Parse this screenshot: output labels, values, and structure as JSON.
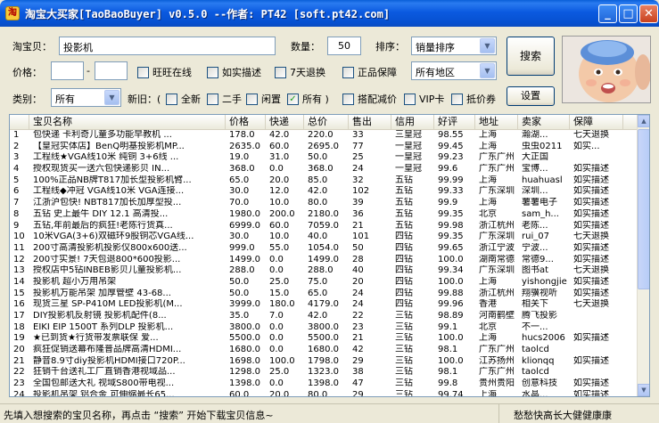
{
  "window": {
    "title": "淘宝大买家[TaoBaoBuyer] v0.5.0 --作者: PT42 [soft.pt42.com]",
    "icon": "app-icon"
  },
  "search": {
    "keyword_label": "淘宝贝：",
    "keyword_value": "投影机",
    "count_label": "数量：",
    "count_value": "50",
    "sort_label": "排序：",
    "sort_value": "销量排序",
    "search_button": "搜索",
    "price_label": "价格：",
    "price_from": "",
    "price_to": "",
    "price_sep": "-",
    "region_value": "所有地区",
    "category_label": "类别：",
    "category_value": "所有",
    "new_label": "新旧：(",
    "settings_button": "设置"
  },
  "filters": [
    {
      "label": "旺旺在线",
      "checked": false
    },
    {
      "label": "如实描述",
      "checked": false
    },
    {
      "label": "7天退换",
      "checked": false
    },
    {
      "label": "正品保障",
      "checked": false
    }
  ],
  "condition_options": [
    {
      "label": "全新",
      "checked": false
    },
    {
      "label": "二手",
      "checked": false
    },
    {
      "label": "闲置",
      "checked": false
    },
    {
      "label": "所有 )",
      "checked": true
    }
  ],
  "extra_filters": [
    {
      "label": "搭配减价",
      "checked": false
    },
    {
      "label": "VIP卡",
      "checked": false
    },
    {
      "label": "抵价券",
      "checked": false
    }
  ],
  "table": {
    "columns": [
      "",
      "宝贝名称",
      "价格",
      "快递",
      "总价",
      "售出",
      "信用",
      "好评",
      "地址",
      "卖家",
      "保障"
    ],
    "rows": [
      [
        "1",
        "包快递 卡利奇儿童多功能早教机 ...",
        "178.0",
        "42.0",
        "220.0",
        "33",
        "三皇冠",
        "98.55",
        "上海",
        "瀚湖...",
        "七天退换"
      ],
      [
        "2",
        "【皇冠实体店】BenQ明基投影机MP...",
        "2635.0",
        "60.0",
        "2695.0",
        "77",
        "一皇冠",
        "99.45",
        "上海",
        "虫虫0211",
        "如实..."
      ],
      [
        "3",
        "工程线★VGA线10米 纯铜 3+6线 ...",
        "19.0",
        "31.0",
        "50.0",
        "25",
        "一皇冠",
        "99.23",
        "广东广州",
        "大正国",
        ""
      ],
      [
        "4",
        "授权现货买一送六包快递影贝 IN...",
        "368.0",
        "0.0",
        "368.0",
        "24",
        "一皇冠",
        "99.6",
        "广东广州",
        "宝博...",
        "如实描述"
      ],
      [
        "5",
        "100%正品NB牌T817加长型投影机臂...",
        "65.0",
        "20.0",
        "85.0",
        "32",
        "五钻",
        "99.99",
        "上海",
        "huahuasl",
        "如实描述"
      ],
      [
        "6",
        "工程线◆冲冠 VGA线10米 VGA连接...",
        "30.0",
        "12.0",
        "42.0",
        "102",
        "五钻",
        "99.33",
        "广东深圳",
        "深圳...",
        "如实描述"
      ],
      [
        "7",
        "江浙沪包快! NBT817加长加厚型投...",
        "70.0",
        "10.0",
        "80.0",
        "39",
        "五钻",
        "99.9",
        "上海",
        "薯薯电子",
        "如实描述"
      ],
      [
        "8",
        "五钻 史上最牛 DIY 12.1 高清投...",
        "1980.0",
        "200.0",
        "2180.0",
        "36",
        "五钻",
        "99.35",
        "北京",
        "sam_h...",
        "如实描述"
      ],
      [
        "9",
        "五钻,年前最后的疯狂!老陈行货真...",
        "6999.0",
        "60.0",
        "7059.0",
        "21",
        "五钻",
        "99.98",
        "浙江杭州",
        "老陈...",
        "如实描述"
      ],
      [
        "10",
        "10米VGA(3+6)双磁环9股铜芯VGA线...",
        "30.0",
        "10.0",
        "40.0",
        "101",
        "四钻",
        "99.35",
        "广东深圳",
        "rui_07",
        "七天退换"
      ],
      [
        "11",
        "200寸高清投影机投影仪800x600送...",
        "999.0",
        "55.0",
        "1054.0",
        "50",
        "四钻",
        "99.65",
        "浙江宁波",
        "宁波...",
        "如实描述"
      ],
      [
        "12",
        "200寸实景! 7天包退800*600投影...",
        "1499.0",
        "0.0",
        "1499.0",
        "28",
        "四钻",
        "100.0",
        "湖南常德",
        "常德9...",
        "如实描述"
      ],
      [
        "13",
        "授权店中5钻INBEB影贝儿童投影机...",
        "288.0",
        "0.0",
        "288.0",
        "40",
        "四钻",
        "99.34",
        "广东深圳",
        "图书at",
        "七天退换"
      ],
      [
        "14",
        "投影机 超小万用吊架",
        "50.0",
        "25.0",
        "75.0",
        "20",
        "四钻",
        "100.0",
        "上海",
        "yishongjie",
        "如实描述"
      ],
      [
        "15",
        "投影机万能吊架 加厚管壁 43-68...",
        "50.0",
        "15.0",
        "65.0",
        "24",
        "四钻",
        "99.88",
        "浙江杭州",
        "翔骥视听",
        "如实描述"
      ],
      [
        "16",
        "现货三星 SP-P410M LED投影机(M...",
        "3999.0",
        "180.0",
        "4179.0",
        "24",
        "四钻",
        "99.96",
        "香港",
        "相关下",
        "七天退换"
      ],
      [
        "17",
        "DIY投影机反射镜 投影机配件(8...",
        "35.0",
        "7.0",
        "42.0",
        "22",
        "三钻",
        "98.89",
        "河南鹤壁",
        "腾飞投影",
        ""
      ],
      [
        "18",
        "EIKI EIP 1500T 系列DLP 投影机...",
        "3800.0",
        "0.0",
        "3800.0",
        "23",
        "三钻",
        "99.1",
        "北京",
        "不一...",
        ""
      ],
      [
        "19",
        "★已到货★行货带发票联保 爱...",
        "5500.0",
        "0.0",
        "5500.0",
        "21",
        "三钻",
        "100.0",
        "上海",
        "hucs2006",
        "如实描述"
      ],
      [
        "20",
        "疯狂促销送幕布隆普品牌高清HDMI...",
        "1680.0",
        "0.0",
        "1680.0",
        "42",
        "三钻",
        "98.1",
        "广东广州",
        "taolcd",
        ""
      ],
      [
        "21",
        "静音8.9寸diy投影机HDMI接口720P...",
        "1698.0",
        "100.0",
        "1798.0",
        "29",
        "三钻",
        "100.0",
        "江苏扬州",
        "klionqq",
        "如实描述"
      ],
      [
        "22",
        "狂销千台送礼工厂直销香港视域品...",
        "1298.0",
        "25.0",
        "1323.0",
        "38",
        "三钻",
        "98.1",
        "广东广州",
        "taolcd",
        ""
      ],
      [
        "23",
        "全国包邮送大礼 视域S800带电视...",
        "1398.0",
        "0.0",
        "1398.0",
        "47",
        "三钻",
        "99.8",
        "贵州贵阳",
        "创意科技",
        "如实描述"
      ],
      [
        "24",
        "投影机吊架 铝合金 可伸缩最长65...",
        "60.0",
        "20.0",
        "80.0",
        "29",
        "三钻",
        "99.74",
        "上海",
        "水晶...",
        "如实描述"
      ]
    ]
  },
  "status": {
    "left": "先填入想搜索的宝贝名称，再点击 “搜索” 开始下载宝贝信息~",
    "right": "愁愁快高长大健健康康"
  }
}
